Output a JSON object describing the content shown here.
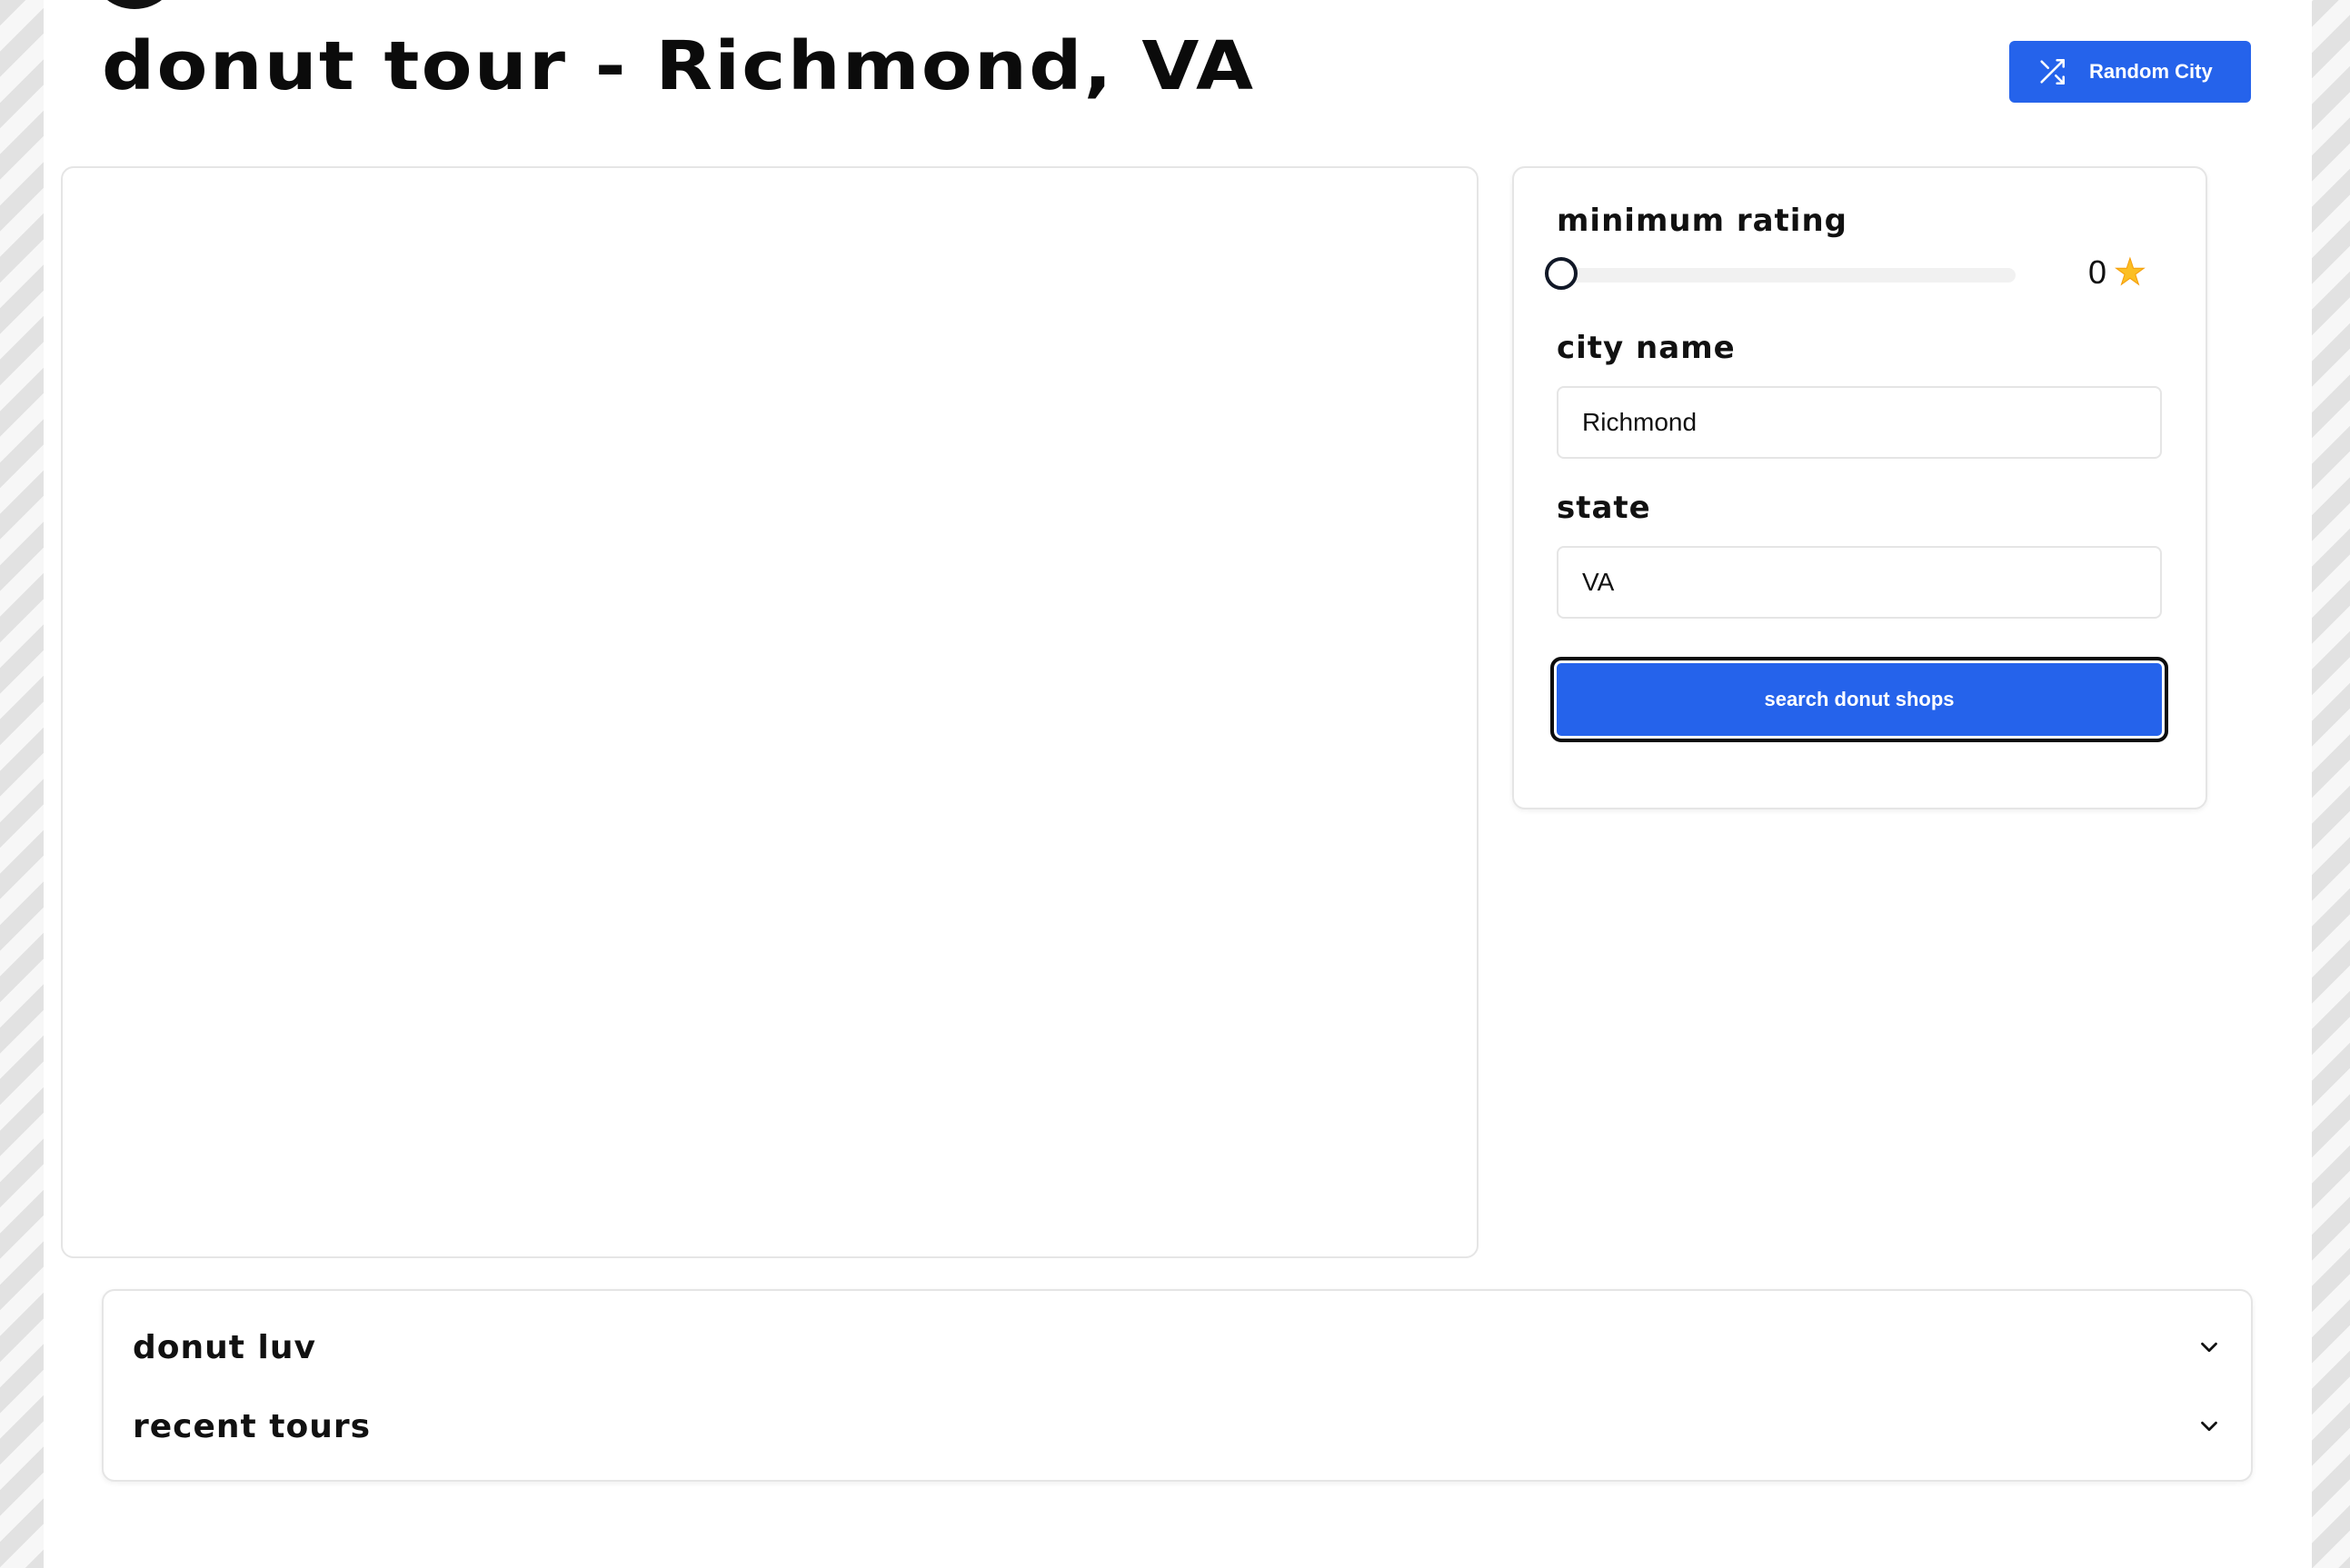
{
  "header": {
    "title": "donut tour - Richmond, VA",
    "random_button_label": "Random City",
    "random_icon": "shuffle-icon"
  },
  "filters": {
    "rating_label": "minimum rating",
    "rating_value": 0,
    "rating_display": "0",
    "rating_icon": "star-icon",
    "city_label": "city name",
    "city_value": "Richmond",
    "state_label": "state",
    "state_value": "VA",
    "search_button_label": "search donut shops"
  },
  "accordion": {
    "items": [
      {
        "title": "donut luv",
        "icon": "chevron-down-icon"
      },
      {
        "title": "recent tours",
        "icon": "chevron-down-icon"
      }
    ]
  },
  "colors": {
    "accent": "#2563eb",
    "star": "#fbbf24",
    "text": "#111111"
  }
}
